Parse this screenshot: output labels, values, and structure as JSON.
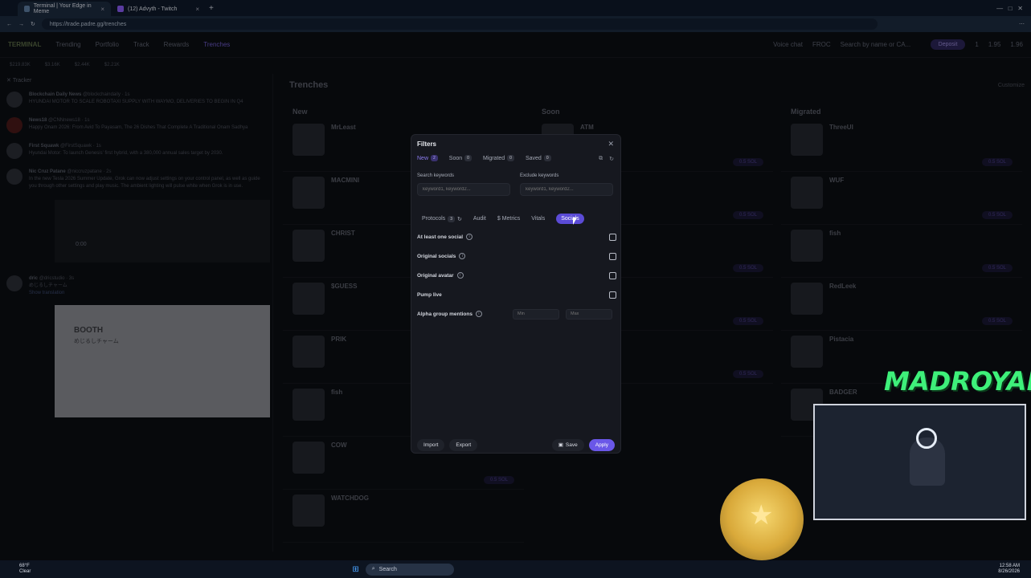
{
  "browser": {
    "tabs": [
      {
        "label": "Terminal | Your Edge in Meme"
      },
      {
        "label": "(12) Advyth - Twitch"
      }
    ],
    "url": "https://trade.padre.gg/trenches"
  },
  "nav": {
    "brand": "TERMINAL",
    "items": [
      "Trending",
      "Portfolio",
      "Track",
      "Rewards",
      "Trenches"
    ],
    "voice_chat": "Voice chat",
    "fdc": "FROC",
    "search_placeholder": "Search by name or CA...",
    "deposit": "Deposit",
    "stats": [
      "1",
      "1.95",
      "1.96"
    ]
  },
  "ticker": [
    "$219.83K",
    "$3.16K",
    "$2.44K",
    "$2.21K"
  ],
  "tracker": {
    "title": "Tracker",
    "items": [
      {
        "name": "Blockchain Daily News",
        "handle": "@blockchaindaily · 1s",
        "text": "HYUNDAI MOTOR TO SCALE ROBOTAXI SUPPLY WITH WAYMO, DELIVERIES TO BEGIN IN Q4"
      },
      {
        "name": "News18",
        "handle": "@CNNnews18 · 1s",
        "text": "Happy Onam 2026: From Avid To Payasam, The 26 Dishes That Complete A Traditional Onam Sadhya"
      },
      {
        "name": "First Squawk",
        "handle": "@FirstSquawk · 1s",
        "text": "Hyundai Motor: To launch Genesis' first hybrid, with a 380,000 annual sales target by 2030."
      },
      {
        "name": "Nic Cruz Patane",
        "handle": "@niccruzpatane · 2s",
        "text": "In the new Tesla 2026 Summer Update, Grok can now adjust settings on your control panel, as well as guide you through other settings and play music. The ambient lighting will pulse white when Grok is in use."
      },
      {
        "name": "dric",
        "handle": "@dricstudio · 3s",
        "text": "めじるしチャーム"
      }
    ],
    "video_time": "0:00",
    "booth_title": "BOOTH",
    "booth_sub": "めじるしチャーム",
    "show_translation": "Show translation"
  },
  "trenches": {
    "title": "Trenches",
    "customize": "Customize",
    "columns": [
      {
        "title": "New",
        "tokens": [
          "MrLeast",
          "MACMINI",
          "CHRIST",
          "$GUESS",
          "PRIK",
          "fish",
          "COW",
          "WATCHDOG"
        ]
      },
      {
        "title": "Soon",
        "tokens": [
          "ATM",
          "",
          "",
          "",
          "",
          "",
          "",
          ""
        ]
      },
      {
        "title": "Migrated",
        "tokens": [
          "ThreeUI",
          "WUF",
          "fish",
          "RedLeek",
          "Pistacia",
          "BADGER"
        ]
      }
    ],
    "buy_label": "0.5 SOL"
  },
  "filters": {
    "title": "Filters",
    "tabs": [
      {
        "label": "New",
        "count": "2"
      },
      {
        "label": "Soon",
        "count": "0"
      },
      {
        "label": "Migrated",
        "count": "0"
      },
      {
        "label": "Saved",
        "count": "0"
      }
    ],
    "search_keywords_label": "Search keywords",
    "exclude_keywords_label": "Exclude keywords",
    "keyword_placeholder": "keyword1, keyword2...",
    "sub_tabs": [
      "Protocols",
      "Audit",
      "$ Metrics",
      "Vitals",
      "Socials"
    ],
    "protocols_count": "3",
    "rows": [
      {
        "label": "At least one social"
      },
      {
        "label": "Original socials"
      },
      {
        "label": "Original avatar"
      },
      {
        "label": "Pump live"
      }
    ],
    "alpha_label": "Alpha group mentions",
    "min_placeholder": "Min",
    "max_placeholder": "Max",
    "import": "Import",
    "export": "Export",
    "save": "Save",
    "apply": "Apply"
  },
  "stream": {
    "overlay_text": "MADROYALS"
  },
  "taskbar": {
    "temp": "68°F",
    "weather": "Clear",
    "search": "Search",
    "time": "12:58 AM",
    "date": "8/26/2026"
  },
  "colors": {
    "accent": "#6a57e8",
    "overlay_green": "#3ef07a"
  }
}
